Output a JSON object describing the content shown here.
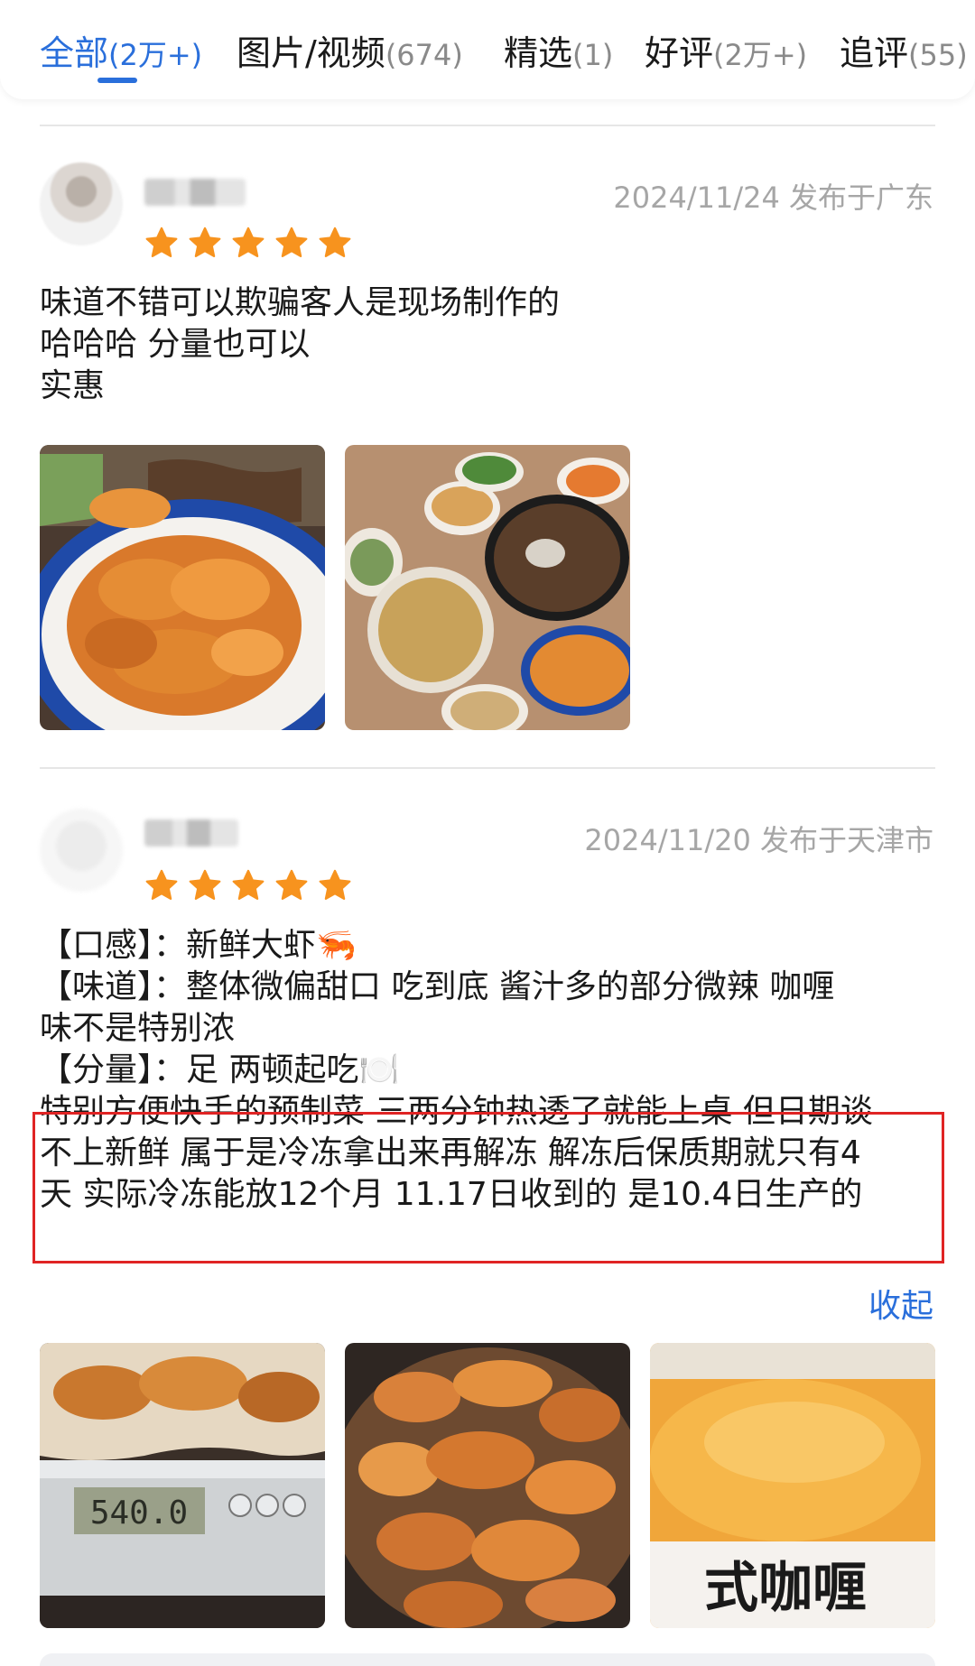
{
  "tabs": [
    {
      "label": "全部",
      "count": "(2万+)",
      "active": true
    },
    {
      "label": "图片/视频",
      "count": "(674)",
      "active": false
    },
    {
      "label": "精选",
      "count": "(1)",
      "active": false
    },
    {
      "label": "好评",
      "count": "(2万+)",
      "active": false
    },
    {
      "label": "追评",
      "count": "(55)",
      "active": false
    }
  ],
  "reviews": [
    {
      "date": "2024/11/24 发布于广东",
      "rating": 5,
      "lines": [
        "味道不错可以欺骗客人是现场制作的",
        "哈哈哈 分量也可以",
        "实惠"
      ],
      "photos": [
        "shrimp-plate-photo",
        "table-dishes-photo"
      ]
    },
    {
      "date": "2024/11/20 发布于天津市",
      "rating": 5,
      "lines": [
        "【口感】：新鲜大虾🦐",
        "【味道】：整体微偏甜口 吃到底 酱汁多的部分微辣 咖喱",
        "味不是特别浓",
        "【分量】：足 两顿起吃🍽️"
      ],
      "highlight_lines": [
        "特别方便快手的预制菜 三两分钟热透了就能上桌 但日期谈",
        "不上新鲜 属于是冷冻拿出来再解冻 解冻后保质期就只有4",
        "天 实际冷冻能放12个月 11.17日收到的 是10.4日生产的"
      ],
      "collapse_label": "收起",
      "photos": [
        "shrimp-on-scale-photo",
        "shrimp-pile-photo",
        "curry-package-photo"
      ],
      "scale_reading": "540.0",
      "package_text": "式咖喱"
    }
  ],
  "colors": {
    "accent": "#2a6fdb",
    "star": "#f7931e",
    "highlight_border": "#e02424"
  }
}
